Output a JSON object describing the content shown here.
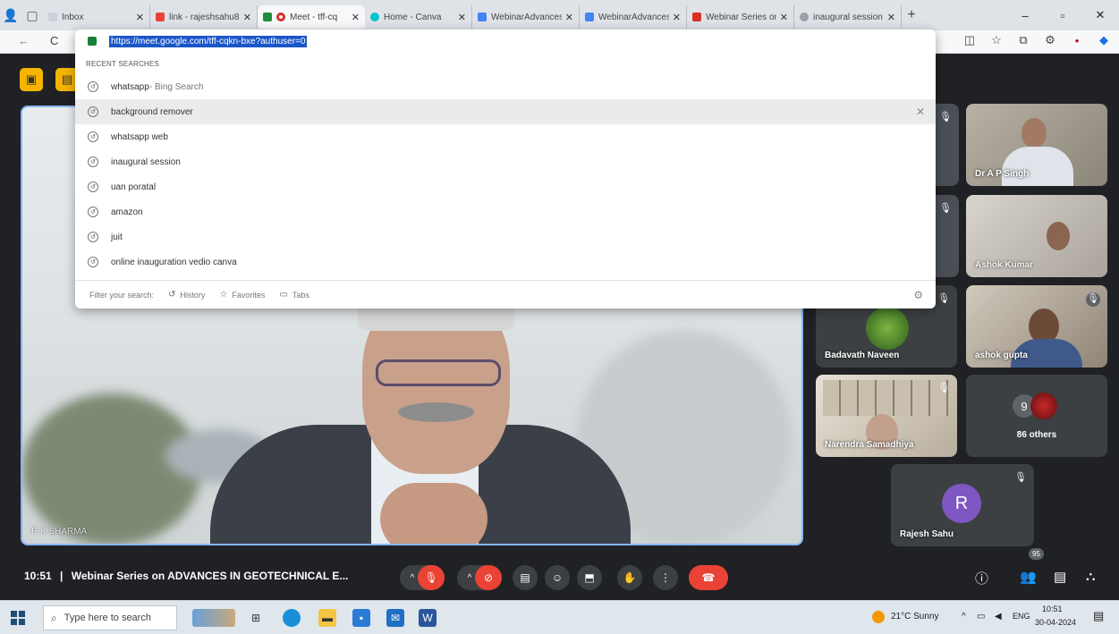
{
  "browser": {
    "tabs": [
      {
        "title": "Inbox",
        "color": "#c9d1d9"
      },
      {
        "title": "link - rajeshsahu8",
        "color": "#ea4335"
      },
      {
        "title": "Meet - tff-cq",
        "color": "#1e8e3e"
      },
      {
        "title": "Home - Canva",
        "color": "#00c4cc"
      },
      {
        "title": "WebinarAdvances",
        "color": "#4285f4"
      },
      {
        "title": "WebinarAdvances",
        "color": "#4285f4"
      },
      {
        "title": "Webinar Series on",
        "color": "#d93025"
      },
      {
        "title": "inaugural session",
        "color": "#9aa0a6"
      }
    ],
    "new_tab": "+",
    "controls": {
      "minimize": "–",
      "maximize": "▫",
      "close": "✕"
    }
  },
  "omnibox": {
    "url": "https://meet.google.com/tff-cqkn-bxe?authuser=0",
    "recent_header": "RECENT SEARCHES",
    "suggestions": [
      {
        "text": "whatsapp",
        "sub": " - Bing Search"
      },
      {
        "text": "background remover",
        "sub": ""
      },
      {
        "text": "whatsapp web",
        "sub": ""
      },
      {
        "text": "inaugural session",
        "sub": ""
      },
      {
        "text": "uan poratal",
        "sub": ""
      },
      {
        "text": "amazon",
        "sub": ""
      },
      {
        "text": "juit",
        "sub": ""
      },
      {
        "text": "online inauguration vedio canva",
        "sub": ""
      }
    ],
    "remove": "✕",
    "filter_label": "Filter your search:",
    "filters": {
      "history": "History",
      "favorites": "Favorites",
      "tabs": "Tabs"
    }
  },
  "meet": {
    "main_speaker": "R K SHARMA",
    "tiles": {
      "dr_ap_singh": "Dr A P Singh",
      "ashok_kumar": "Ashok Kumar",
      "badavath": "Badavath Naveen",
      "ashok_gupta": "ashok gupta",
      "narendra": "Narendra Samadhiya",
      "others_count": "9",
      "others_label": "86 others",
      "rajesh": "Rajesh Sahu",
      "rajesh_initial": "R"
    },
    "bottom": {
      "time": "10:51",
      "separator": "|",
      "title": "Webinar Series on ADVANCES IN GEOTECHNICAL E...",
      "participants_badge": "95"
    },
    "colors": {
      "hangup": "#ea4335",
      "accent": "#8ab4f8"
    }
  },
  "taskbar": {
    "search_placeholder": "Type here to search",
    "weather": "21°C  Sunny",
    "lang": "ENG",
    "time": "10:51",
    "date": "30-04-2024"
  }
}
